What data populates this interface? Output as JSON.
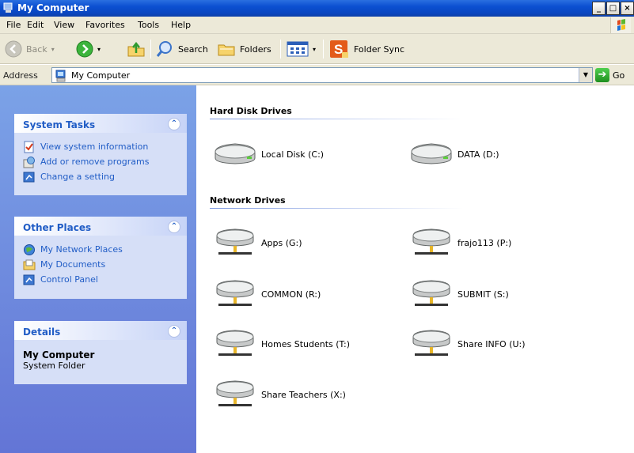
{
  "window": {
    "title": "My Computer"
  },
  "menu": [
    "File",
    "Edit",
    "View",
    "Favorites",
    "Tools",
    "Help"
  ],
  "toolbar": {
    "back": "Back",
    "search": "Search",
    "folders": "Folders",
    "folder_sync": "Folder Sync"
  },
  "address": {
    "label": "Address",
    "value": "My Computer",
    "go": "Go"
  },
  "left": {
    "system_tasks": {
      "title": "System Tasks",
      "items": [
        "View system information",
        "Add or remove programs",
        "Change a setting"
      ]
    },
    "other_places": {
      "title": "Other Places",
      "items": [
        "My Network Places",
        "My Documents",
        "Control Panel"
      ]
    },
    "details": {
      "title": "Details",
      "name": "My Computer",
      "type": "System Folder"
    }
  },
  "main": {
    "hard_disk_title": "Hard Disk Drives",
    "hard_disks": [
      "Local Disk (C:)",
      "DATA (D:)"
    ],
    "network_title": "Network Drives",
    "network_drives": [
      "Apps (G:)",
      "frajo113 (P:)",
      "COMMON (R:)",
      "SUBMIT (S:)",
      "Homes Students (T:)",
      "Share INFO (U:)",
      "Share Teachers (X:)"
    ]
  },
  "colors": {
    "titlebar": "#0b4fd1",
    "panel_link": "#215dc6",
    "left_pane": "#6375d6"
  }
}
